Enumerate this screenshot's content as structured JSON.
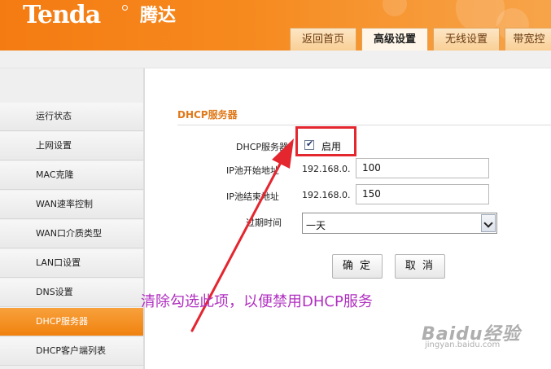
{
  "header": {
    "logo_text": "Tenda",
    "logo_cn": "腾达",
    "tabs": [
      {
        "label": "返回首页"
      },
      {
        "label": "高级设置",
        "active": true
      },
      {
        "label": "无线设置"
      },
      {
        "label": "带宽控"
      }
    ]
  },
  "sidebar": {
    "items": [
      {
        "label": "运行状态"
      },
      {
        "label": "上网设置"
      },
      {
        "label": "MAC克隆"
      },
      {
        "label": "WAN速率控制"
      },
      {
        "label": "WAN口介质类型"
      },
      {
        "label": "LAN口设置"
      },
      {
        "label": "DNS设置"
      },
      {
        "label": "DHCP服务器",
        "active": true
      },
      {
        "label": "DHCP客户端列表"
      }
    ]
  },
  "main": {
    "section_title": "DHCP服务器",
    "dhcp_label": "DHCP服务器",
    "dhcp_enabled": true,
    "dhcp_enable_label": "启用",
    "start_label": "IP池开始地址",
    "end_label": "IP池结束地址",
    "ip_prefix": "192.168.0.",
    "start_value": "100",
    "end_value": "150",
    "lease_label": "过期时间",
    "lease_value": "一天",
    "ok_label": "确 定",
    "cancel_label": "取 消"
  },
  "annotation": {
    "text": "清除勾选此项，以便禁用DHCP服务",
    "highlight_color": "#e4262f",
    "text_color": "#b02fc0"
  },
  "watermark": {
    "main": "Baidu经验",
    "sub": "jingyan.baidu.com"
  },
  "colors": {
    "brand_orange": "#f47b12",
    "active_nav": "#f0820f",
    "section_title": "#e0791a"
  }
}
